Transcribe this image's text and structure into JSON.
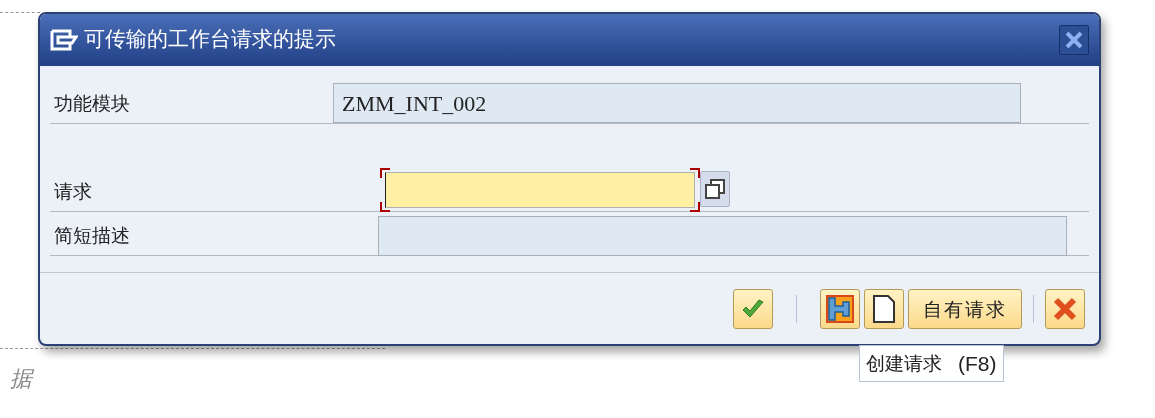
{
  "background": {
    "text": "据"
  },
  "dialog": {
    "title": "可传输的工作台请求的提示",
    "fields": [
      {
        "kind": "readonly",
        "label": "功能模块",
        "value": "ZMM_INT_002"
      },
      {
        "kind": "required",
        "label": "请求",
        "focused": true
      },
      {
        "kind": "readonly",
        "label": "简短描述"
      }
    ],
    "buttons": [
      {
        "kind": "confirm"
      },
      {
        "kind": "separator"
      },
      {
        "kind": "transport"
      },
      {
        "kind": "create"
      },
      {
        "kind": "text",
        "label": "自有请求"
      },
      {
        "kind": "separator"
      },
      {
        "kind": "cancel"
      }
    ],
    "tooltip": {
      "text": "创建请求",
      "shortcut": "(F8)"
    }
  }
}
